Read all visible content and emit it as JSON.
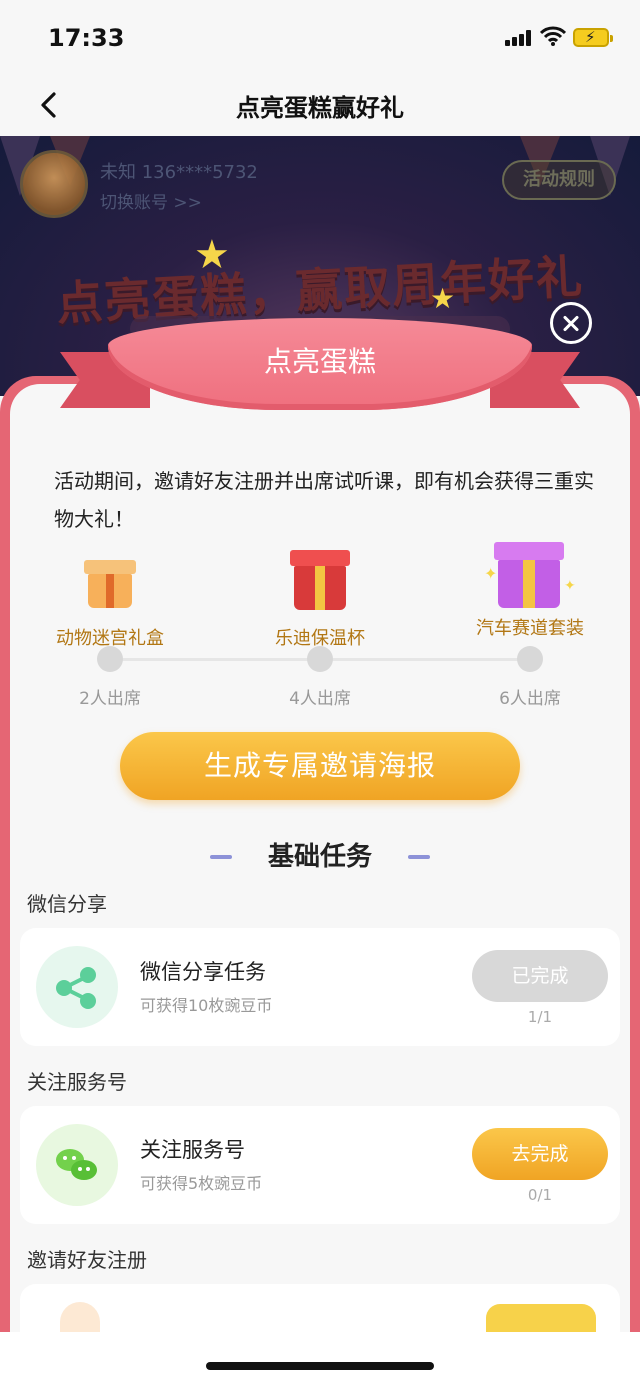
{
  "status_bar": {
    "time": "17:33"
  },
  "nav": {
    "title": "点亮蛋糕赢好礼"
  },
  "banner": {
    "user_name": "未知  136****5732",
    "switch_account": "切换账号 >>",
    "rules": "活动规则",
    "title": "点亮蛋糕，赢取周年好礼"
  },
  "modal": {
    "ribbon": "点亮蛋糕",
    "intro": "活动期间，邀请好友注册并出席试听课，即有机会获得三重实物大礼！",
    "rewards": [
      {
        "label": "动物迷宫礼盒",
        "milestone": "2人出席",
        "color": "#f0a53a"
      },
      {
        "label": "乐迪保温杯",
        "milestone": "4人出席",
        "color": "#e23b3b"
      },
      {
        "label": "汽车赛道套装",
        "milestone": "6人出席",
        "color": "#c05ae0"
      }
    ],
    "poster_button": "生成专属邀请海报",
    "section_title": "基础任务",
    "groups": [
      {
        "label": "微信分享",
        "task": {
          "title": "微信分享任务",
          "desc": "可获得10枚豌豆币",
          "button": "已完成",
          "progress": "1/1",
          "icon": "share-icon",
          "done": true
        }
      },
      {
        "label": "关注服务号",
        "task": {
          "title": "关注服务号",
          "desc": "可获得5枚豌豆币",
          "button": "去完成",
          "progress": "0/1",
          "icon": "wechat-icon",
          "done": false
        }
      },
      {
        "label": "邀请好友注册"
      }
    ]
  }
}
